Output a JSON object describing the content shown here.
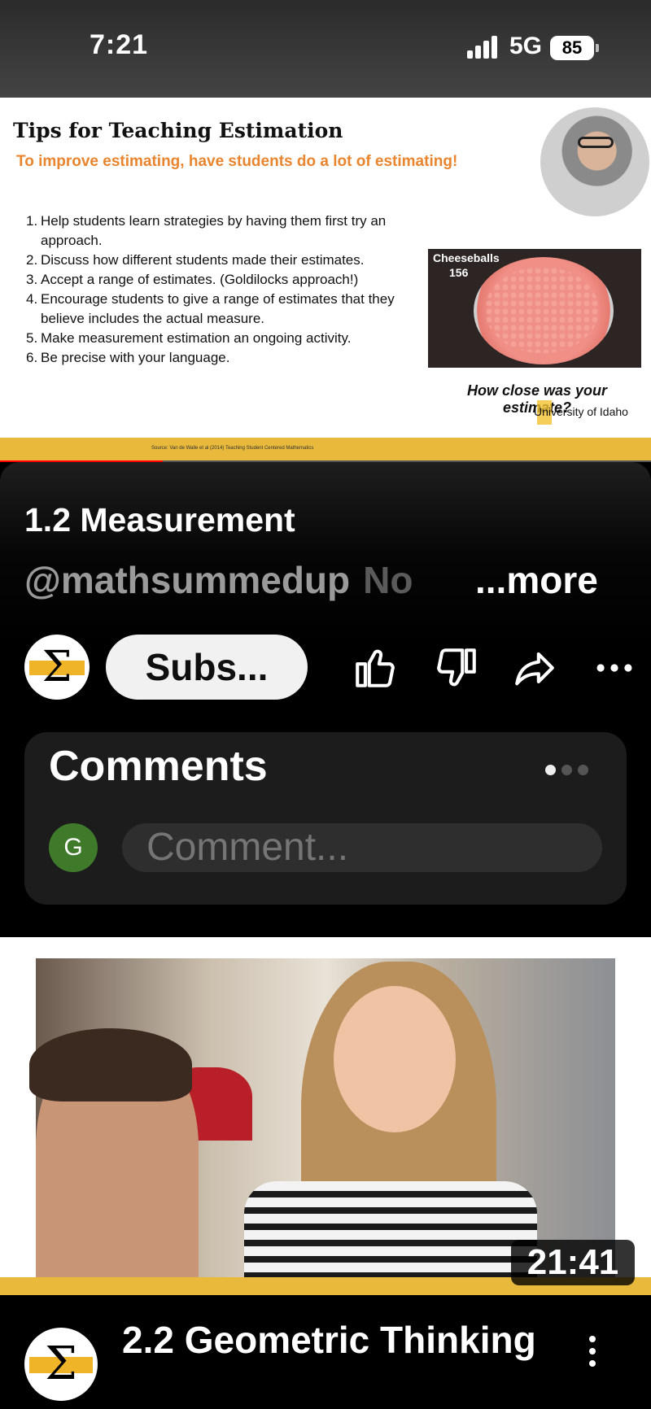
{
  "status_bar": {
    "time": "7:21",
    "network": "5G",
    "battery": "85"
  },
  "video": {
    "slide_title": "Tips for Teaching Estimation",
    "slide_subtitle": "To improve estimating, have students do a lot of estimating!",
    "tips": [
      {
        "num": "1.",
        "text": "Help students learn strategies by having them first try an approach."
      },
      {
        "num": "2.",
        "text": "Discuss how different students made their estimates."
      },
      {
        "num": "3.",
        "text": "Accept a range of estimates.  (Goldilocks approach!)"
      },
      {
        "num": "4.",
        "text": "Encourage students to give a range of estimates that they believe includes the actual measure."
      },
      {
        "num": "5.",
        "text": "Make measurement estimation an ongoing activity."
      },
      {
        "num": "6.",
        "text": "Be precise with your language."
      }
    ],
    "image_label": "Cheeseballs",
    "image_count": "156",
    "caption": "How close was your estimate?",
    "logo_text": "University of Idaho",
    "source": "Source: Van de Walle et al (2014) Teaching Student Centered Mathematics",
    "progress_fraction": 0.25
  },
  "meta": {
    "title": "1.2 Measurement",
    "handle": "@mathsummedup",
    "snippet": "No",
    "more": "...more",
    "subscribe": "Subs...",
    "comments_title": "Comments",
    "avatar_initial": "G",
    "comment_placeholder": "Comment..."
  },
  "next_video": {
    "duration": "21:41",
    "title": "2.2 Geometric Thinking"
  },
  "colors": {
    "accent_gold": "#e8b93b",
    "subtitle_orange": "#e8852e",
    "avatar_green": "#3f7a2a"
  },
  "icons": [
    "signal-icon",
    "battery-icon",
    "like-icon",
    "dislike-icon",
    "share-icon",
    "more-icon",
    "kebab-icon"
  ]
}
